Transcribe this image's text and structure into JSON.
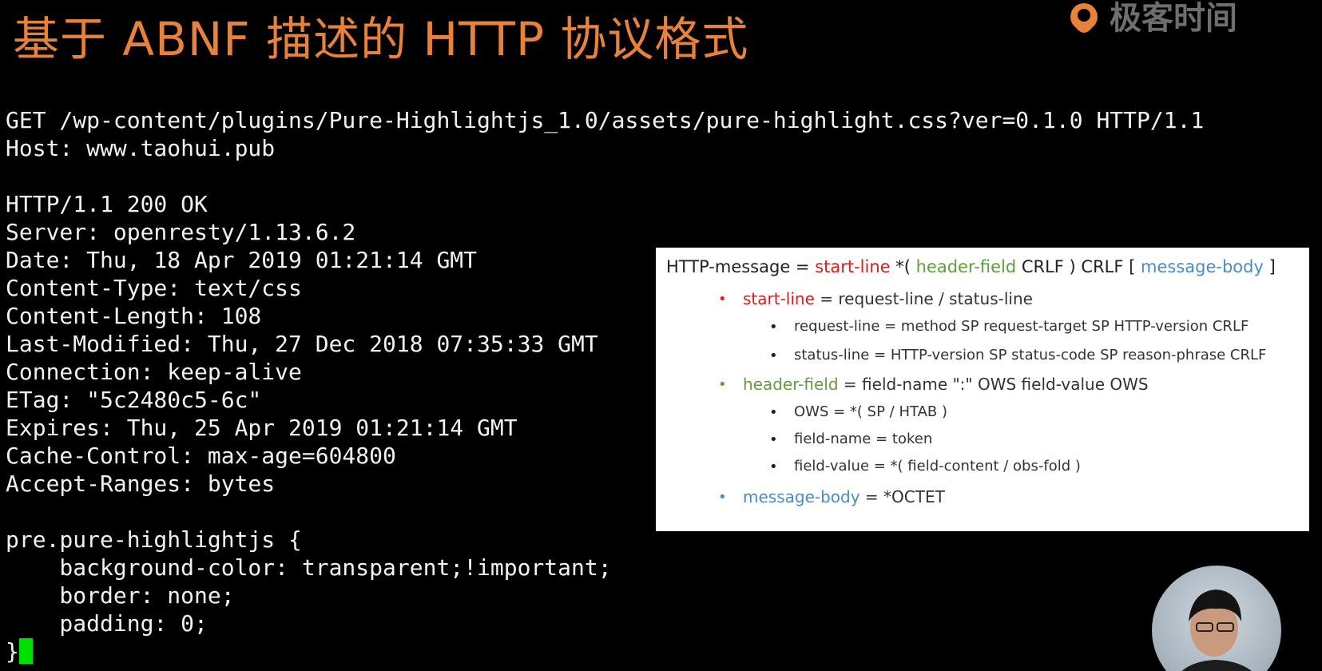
{
  "slide": {
    "title": "基于 ABNF 描述的 HTTP 协议格式",
    "logo_text": "极客时间"
  },
  "terminal": {
    "lines": [
      "GET /wp-content/plugins/Pure-Highlightjs_1.0/assets/pure-highlight.css?ver=0.1.0 HTTP/1.1",
      "Host: www.taohui.pub",
      "",
      "HTTP/1.1 200 OK",
      "Server: openresty/1.13.6.2",
      "Date: Thu, 18 Apr 2019 01:21:14 GMT",
      "Content-Type: text/css",
      "Content-Length: 108",
      "Last-Modified: Thu, 27 Dec 2018 07:35:33 GMT",
      "Connection: keep-alive",
      "ETag: \"5c2480c5-6c\"",
      "Expires: Thu, 25 Apr 2019 01:21:14 GMT",
      "Cache-Control: max-age=604800",
      "Accept-Ranges: bytes",
      "",
      "pre.pure-highlightjs {",
      "    background-color: transparent;!important;",
      "    border: none;",
      "    padding: 0;",
      "}"
    ]
  },
  "grammar": {
    "main": {
      "lhs": "HTTP-message = ",
      "start_line": "start-line",
      "mid1": " *( ",
      "header_field": "header-field",
      "mid2": " CRLF ) CRLF [ ",
      "message_body": "message-body",
      "end": " ]"
    },
    "items": [
      {
        "bullet": "•",
        "term": "start-line",
        "rest": " = request-line / status-line",
        "subs": [
          "request-line = method SP request-target SP HTTP-version CRLF",
          "status-line = HTTP-version SP status-code SP reason-phrase CRLF"
        ]
      },
      {
        "bullet": "•",
        "term": "header-field",
        "rest": " = field-name \":\" OWS field-value OWS",
        "subs": [
          "OWS = *( SP / HTAB )",
          "field-name = token",
          "field-value = *( field-content / obs-fold )"
        ]
      },
      {
        "bullet": "•",
        "term": "message-body",
        "rest": " = *OCTET",
        "subs": []
      }
    ],
    "sub_bullet": "•"
  },
  "colors": {
    "title": "#e8823a",
    "start_line": "#d42020",
    "header_field": "#5f9e3c",
    "message_body": "#4a8cc2",
    "cursor": "#00e000"
  }
}
